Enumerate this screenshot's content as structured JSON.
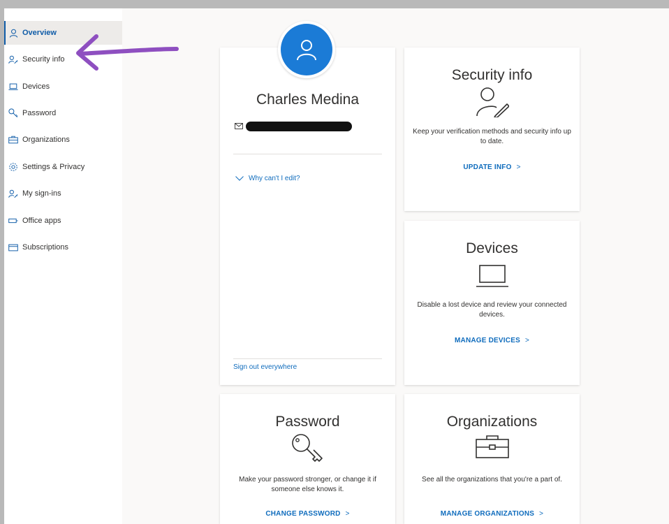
{
  "sidebar": {
    "items": [
      {
        "label": "Overview",
        "icon": "person-icon",
        "active": true
      },
      {
        "label": "Security info",
        "icon": "person-key-icon"
      },
      {
        "label": "Devices",
        "icon": "laptop-icon"
      },
      {
        "label": "Password",
        "icon": "key-icon"
      },
      {
        "label": "Organizations",
        "icon": "briefcase-icon"
      },
      {
        "label": "Settings & Privacy",
        "icon": "gear-icon"
      },
      {
        "label": "My sign-ins",
        "icon": "person-key-icon"
      },
      {
        "label": "Office apps",
        "icon": "apps-icon"
      },
      {
        "label": "Subscriptions",
        "icon": "card-icon"
      }
    ]
  },
  "profile": {
    "name": "Charles Medina",
    "why_edit": "Why can't I edit?",
    "sign_out": "Sign out everywhere"
  },
  "cards": {
    "security": {
      "title": "Security info",
      "desc": "Keep your verification methods and security info up to date.",
      "link": "UPDATE INFO"
    },
    "devices": {
      "title": "Devices",
      "desc": "Disable a lost device and review your connected devices.",
      "link": "MANAGE DEVICES"
    },
    "password": {
      "title": "Password",
      "desc": "Make your password stronger, or change it if someone else knows it.",
      "link": "CHANGE PASSWORD"
    },
    "organizations": {
      "title": "Organizations",
      "desc": "See all the organizations that you're a part of.",
      "link": "MANAGE ORGANIZATIONS"
    }
  },
  "link_chevron": ">",
  "colors": {
    "accent": "#0f6cbd",
    "avatar": "#1b7bd6",
    "arrow_annotation": "#8e4fc0"
  }
}
